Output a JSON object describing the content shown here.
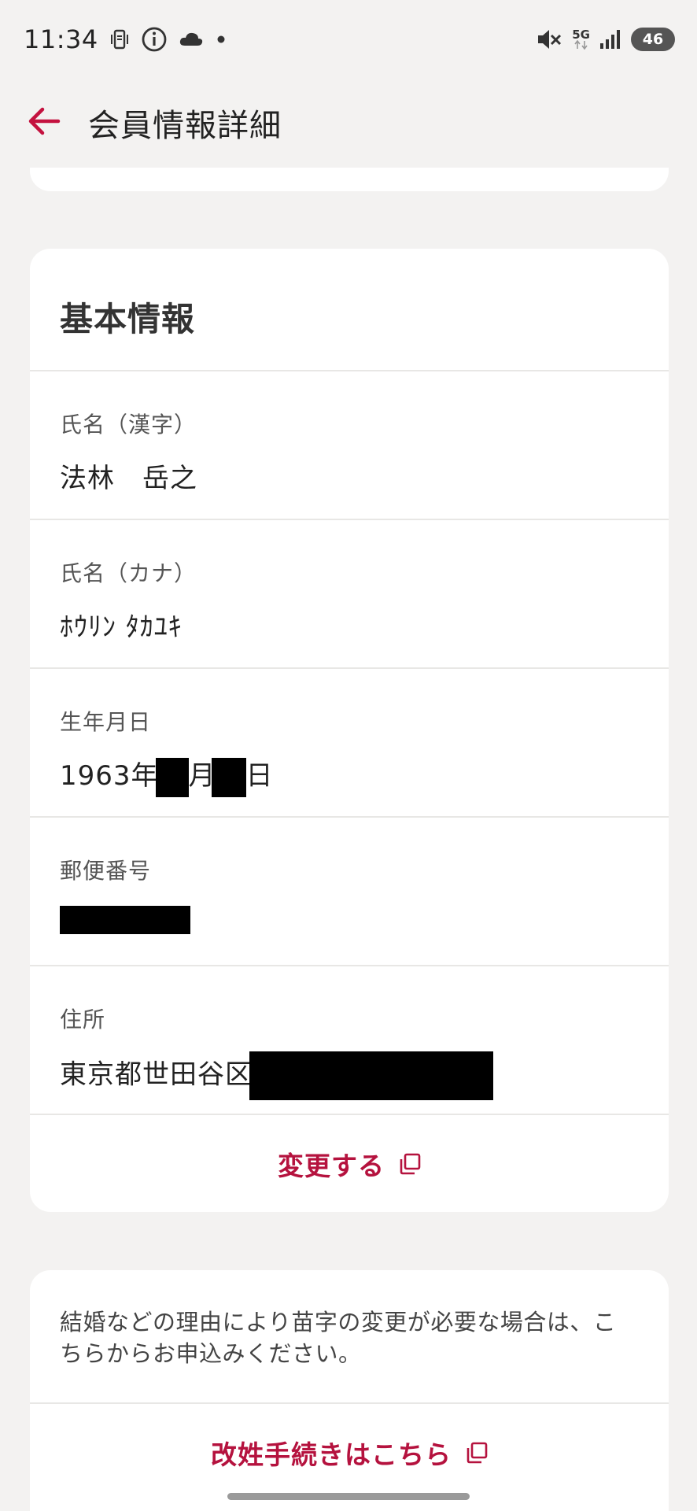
{
  "status_bar": {
    "time": "11:34",
    "network_label": "5G",
    "battery_level": "46"
  },
  "app_bar": {
    "title": "会員情報詳細"
  },
  "basic_info": {
    "title": "基本情報",
    "fields": [
      {
        "label": "氏名（漢字）",
        "value": "法林　岳之"
      },
      {
        "label": "氏名（カナ）",
        "value": "ﾎｳﾘﾝ ﾀｶﾕｷ"
      },
      {
        "label": "生年月日",
        "value_year": "1963年",
        "value_month_unit": "月",
        "value_day_unit": "日"
      },
      {
        "label": "郵便番号",
        "value": ""
      },
      {
        "label": "住所",
        "value": "東京都世田谷区"
      }
    ],
    "action_label": "変更する"
  },
  "notice": {
    "text": "結婚などの理由により苗字の変更が必要な場合は、こちらからお申込みください。",
    "action_label": "改姓手続きはこちら"
  },
  "colors": {
    "accent": "#b5123e",
    "background": "#f3f2f1",
    "card": "#ffffff"
  }
}
